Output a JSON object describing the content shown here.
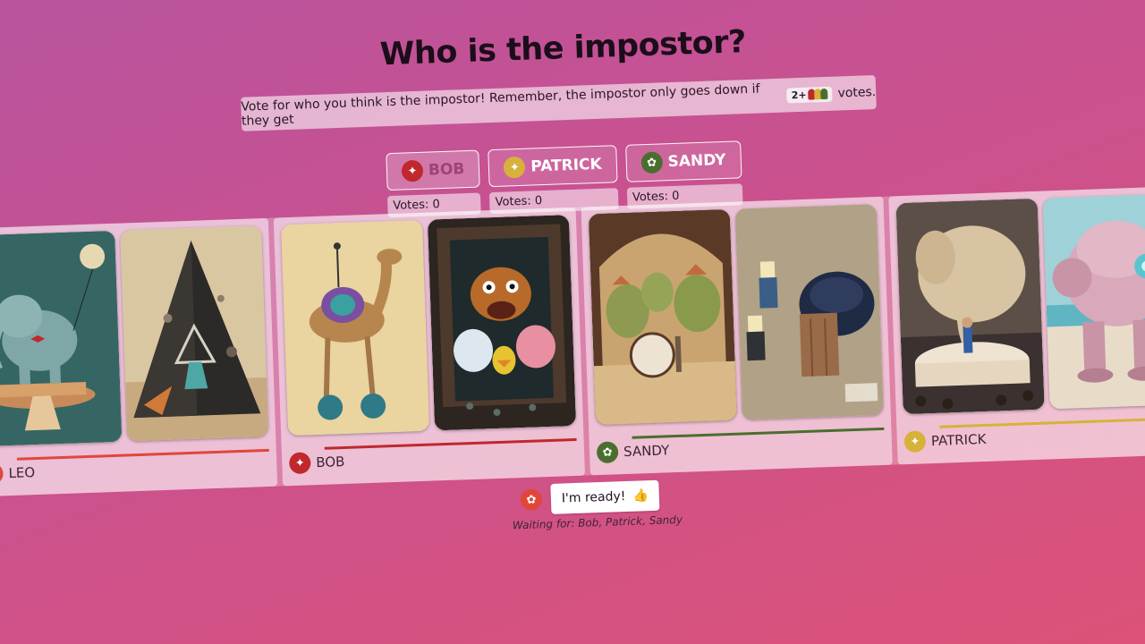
{
  "title": "Who is the impostor?",
  "notice": {
    "before": "Vote for who you think is the impostor! Remember, the impostor only goes down if they get",
    "pill": "2+",
    "after": "votes."
  },
  "vote_options": [
    {
      "name": "BOB",
      "votes": "Votes: 0",
      "color": "#c0282d",
      "icon": "bird-icon"
    },
    {
      "name": "PATRICK",
      "votes": "Votes: 0",
      "color": "#d6b23a",
      "icon": "bird-icon"
    },
    {
      "name": "SANDY",
      "votes": "Votes: 0",
      "color": "#4a6e2e",
      "icon": "critter-icon"
    }
  ],
  "players": [
    {
      "name": "LEO",
      "color": "#e0473c",
      "line": "#e0473c"
    },
    {
      "name": "BOB",
      "color": "#c0282d",
      "line": "#c0282d"
    },
    {
      "name": "SANDY",
      "color": "#4a6e2e",
      "line": "#4a6e2e"
    },
    {
      "name": "PATRICK",
      "color": "#d6b23a",
      "line": "#d6b23a"
    }
  ],
  "cards": [
    {
      "subject": "elephant on pedestal"
    },
    {
      "subject": "cone pyramid"
    },
    {
      "subject": "camel on unicycle"
    },
    {
      "subject": "birds in cave"
    },
    {
      "subject": "dinosaur band"
    },
    {
      "subject": "lego figures with beetle"
    },
    {
      "subject": "elephant at cake"
    },
    {
      "subject": "pink robot"
    }
  ],
  "ready": {
    "label": "I'm ready!",
    "waiting": "Waiting for: Bob, Patrick, Sandy",
    "color": "#e0473c"
  }
}
